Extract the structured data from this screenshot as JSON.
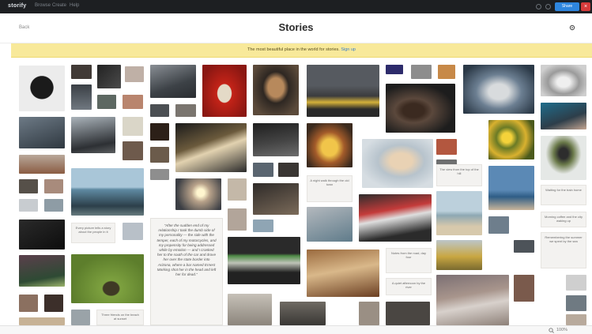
{
  "topbar": {
    "brand": "storify",
    "nav": [
      "Browse",
      "Create",
      "Help"
    ],
    "share_label": "Share",
    "close_label": "×"
  },
  "header": {
    "back_label": "Back",
    "title": "Stories"
  },
  "banner": {
    "text": "The most beautiful place in the world for stories.",
    "link": "Sign up"
  },
  "cards": [
    "Every picture tells a story about the people in it",
    "Three friends on the beach at sunset",
    "A night walk through the old town",
    "Notes from the road, day four",
    "A quiet afternoon by the river",
    "The view from the top of the hill",
    "Waiting for the train home",
    "Morning coffee and the city waking up",
    "Remembering the summer we spent by the sea"
  ],
  "quote": "\"After the sudden end of my relationship I took the dumb side of my personality — the side with the temper, each of my motorcycles, and my propensity for being addressed while by emotion — and I cranked her to the south of the car and drove her over the state border into Arizona, where a bar named Ernest Marking shot her in the head and left her for dead.\"",
  "statusbar": {
    "zoom": "100%"
  },
  "colors": {
    "topbar": "#1d1f22",
    "banner": "#f8e99a",
    "share": "#2e86de",
    "close": "#d63b3b"
  }
}
